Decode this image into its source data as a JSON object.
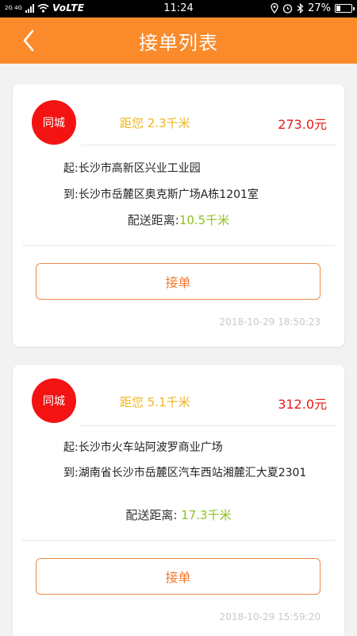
{
  "status_bar": {
    "network": "2G 4G",
    "volte": "VoLTE",
    "time": "11:24",
    "battery": "27%",
    "battery_level": 0.27
  },
  "header": {
    "title": "接单列表"
  },
  "orders": [
    {
      "badge": "同城",
      "distance_text": "距您 2.3千米",
      "price": "273.0元",
      "from": "起:长沙市高新区兴业工业园",
      "to": "到:长沙市岳麓区奥克斯广场A栋1201室",
      "delivery_label": "配送距离:",
      "delivery_value": "10.5千米",
      "button_label": "接单",
      "timestamp": "2018-10-29 18:50:23"
    },
    {
      "badge": "同城",
      "distance_text": "距您 5.1千米",
      "price": "312.0元",
      "from": "起:长沙市火车站阿波罗商业广场",
      "to": "到:湖南省长沙市岳麓区汽车西站湘麓汇大夏2301",
      "delivery_label": "配送距离: ",
      "delivery_value": "17.3千米",
      "button_label": "接单",
      "timestamp": "2018-10-29 15:59:20"
    }
  ],
  "colors": {
    "header": "#fb8a2a",
    "badge": "#f31313",
    "distance": "#f0b623",
    "price": "#e81a1a",
    "delivery_value": "#8cc21f",
    "button_border": "#f08a48"
  }
}
